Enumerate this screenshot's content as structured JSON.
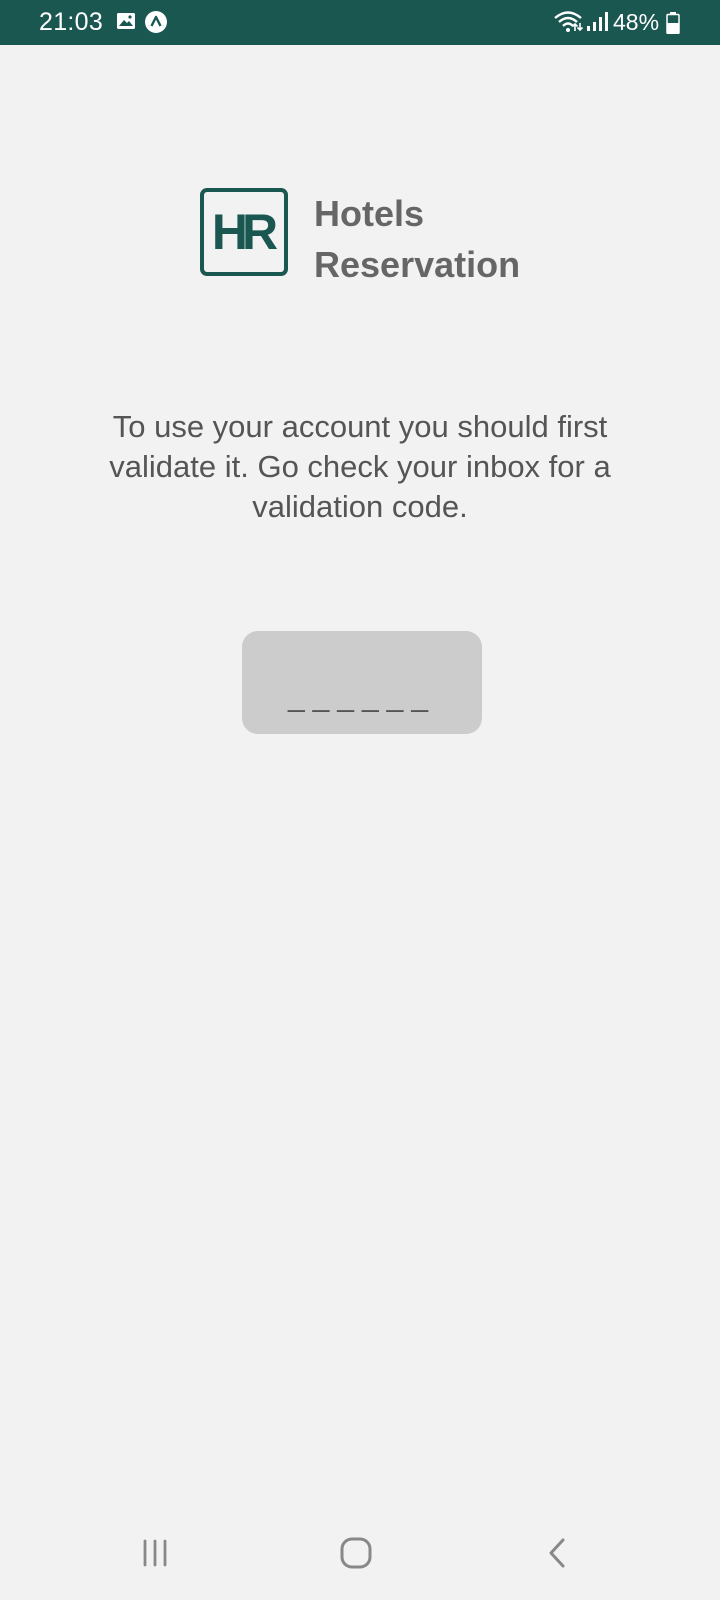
{
  "status_bar": {
    "time": "21:03",
    "battery_percent": "48%",
    "icons": [
      "gallery-icon",
      "app-notification-icon",
      "wifi-icon",
      "signal-icon",
      "battery-icon"
    ]
  },
  "logo": {
    "mark": "HR",
    "title_line1": "Hotels",
    "title_line2": "Reservation"
  },
  "validation": {
    "message": "To use your account you should first validate it. Go check your inbox for a validation code.",
    "code_placeholder": "______",
    "code_value": ""
  },
  "nav_bar": {
    "icons": [
      "recents-icon",
      "home-icon",
      "back-icon"
    ]
  },
  "colors": {
    "status_bar": "#1b5751",
    "brand": "#1b5751",
    "background": "#f2f2f2",
    "input_background": "#cccccc",
    "text": "#555555",
    "logo_text": "#666666"
  }
}
